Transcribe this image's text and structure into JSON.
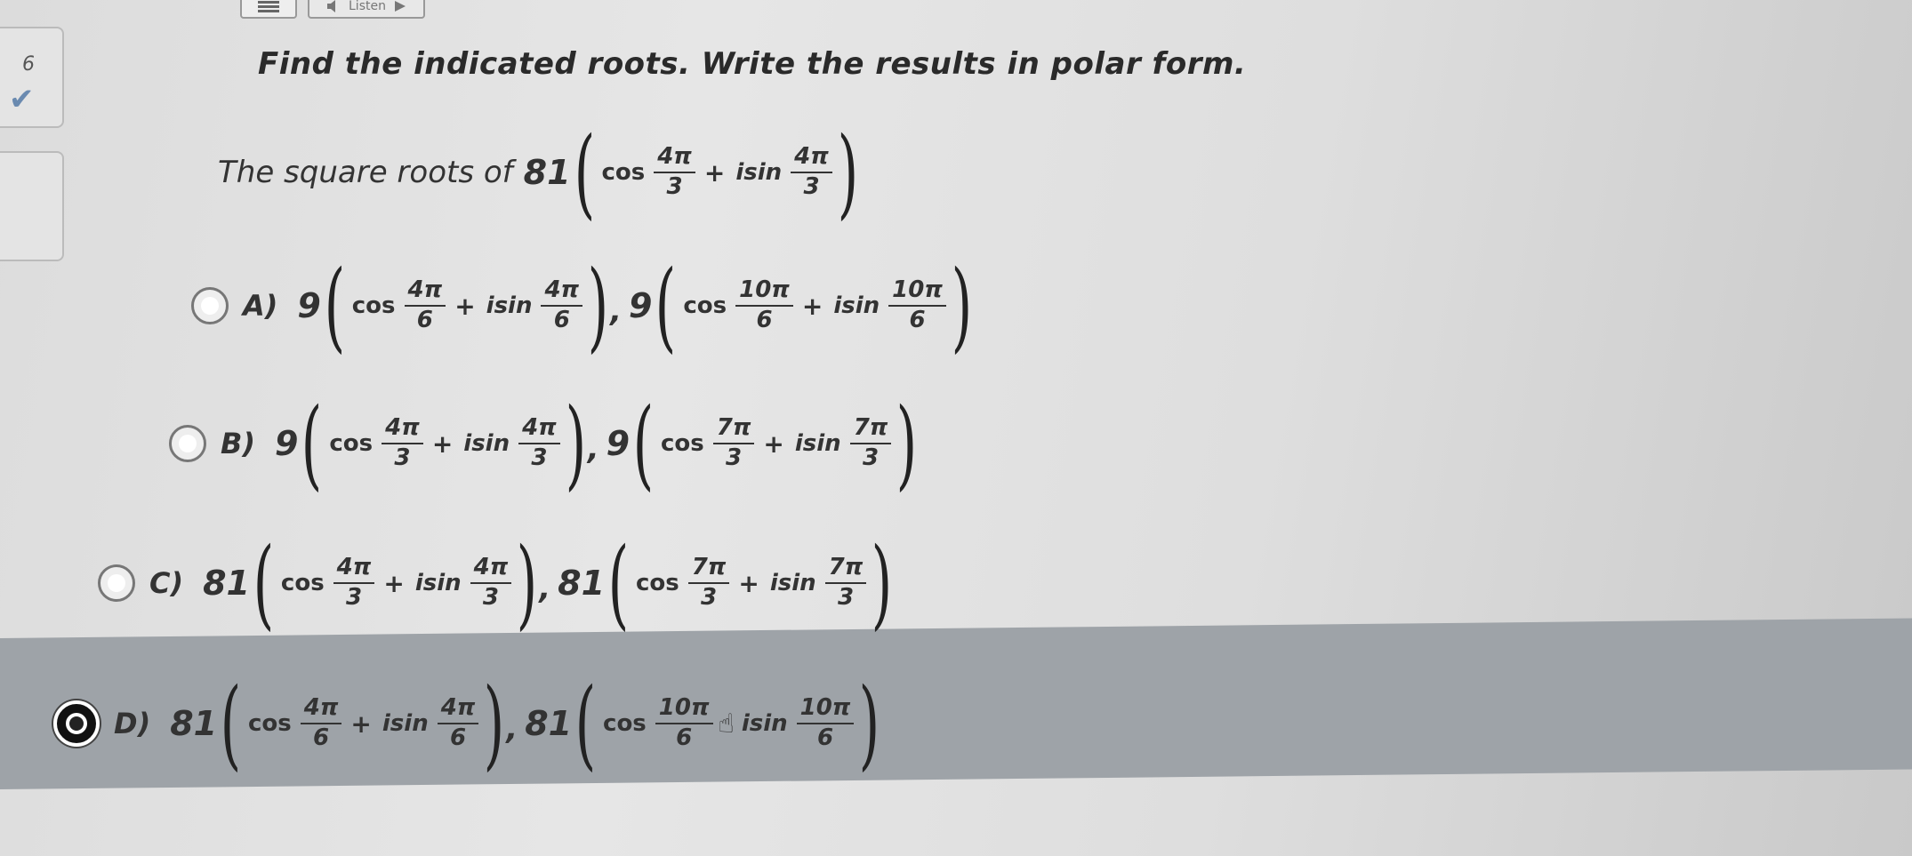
{
  "toolbar": {
    "listen_label": "Listen"
  },
  "sidebar": {
    "question_number": "6",
    "check_mark": "✔"
  },
  "instruction": "Find the indicated roots. Write the results in polar form.",
  "problem": {
    "label": "The square roots of",
    "coef": "81",
    "cos": "cos",
    "plus": "+",
    "isin": "isin",
    "num1": "4π",
    "den1": "3",
    "num2": "4π",
    "den2": "3"
  },
  "options": [
    {
      "letter": "A)",
      "selected": false,
      "terms": [
        {
          "coef": "9",
          "num1": "4π",
          "den1": "6",
          "num2": "4π",
          "den2": "6"
        },
        {
          "coef": "9",
          "num1": "10π",
          "den1": "6",
          "num2": "10π",
          "den2": "6"
        }
      ]
    },
    {
      "letter": "B)",
      "selected": false,
      "terms": [
        {
          "coef": "9",
          "num1": "4π",
          "den1": "3",
          "num2": "4π",
          "den2": "3"
        },
        {
          "coef": "9",
          "num1": "7π",
          "den1": "3",
          "num2": "7π",
          "den2": "3"
        }
      ]
    },
    {
      "letter": "C)",
      "selected": false,
      "terms": [
        {
          "coef": "81",
          "num1": "4π",
          "den1": "3",
          "num2": "4π",
          "den2": "3"
        },
        {
          "coef": "81",
          "num1": "7π",
          "den1": "3",
          "num2": "7π",
          "den2": "3"
        }
      ]
    },
    {
      "letter": "D)",
      "selected": true,
      "terms": [
        {
          "coef": "81",
          "num1": "4π",
          "den1": "6",
          "num2": "4π",
          "den2": "6"
        },
        {
          "coef": "81",
          "num1": "10π",
          "den1": "6",
          "num2": "10π",
          "den2": "6"
        }
      ]
    }
  ],
  "math": {
    "cos": "cos",
    "plus": "+",
    "isin": "isin",
    "comma": ",",
    "lparen": "(",
    "rparen": ")"
  },
  "colors": {
    "background": "#e2e2e2",
    "selected_band": "#9ea3a8",
    "text": "#333333"
  }
}
